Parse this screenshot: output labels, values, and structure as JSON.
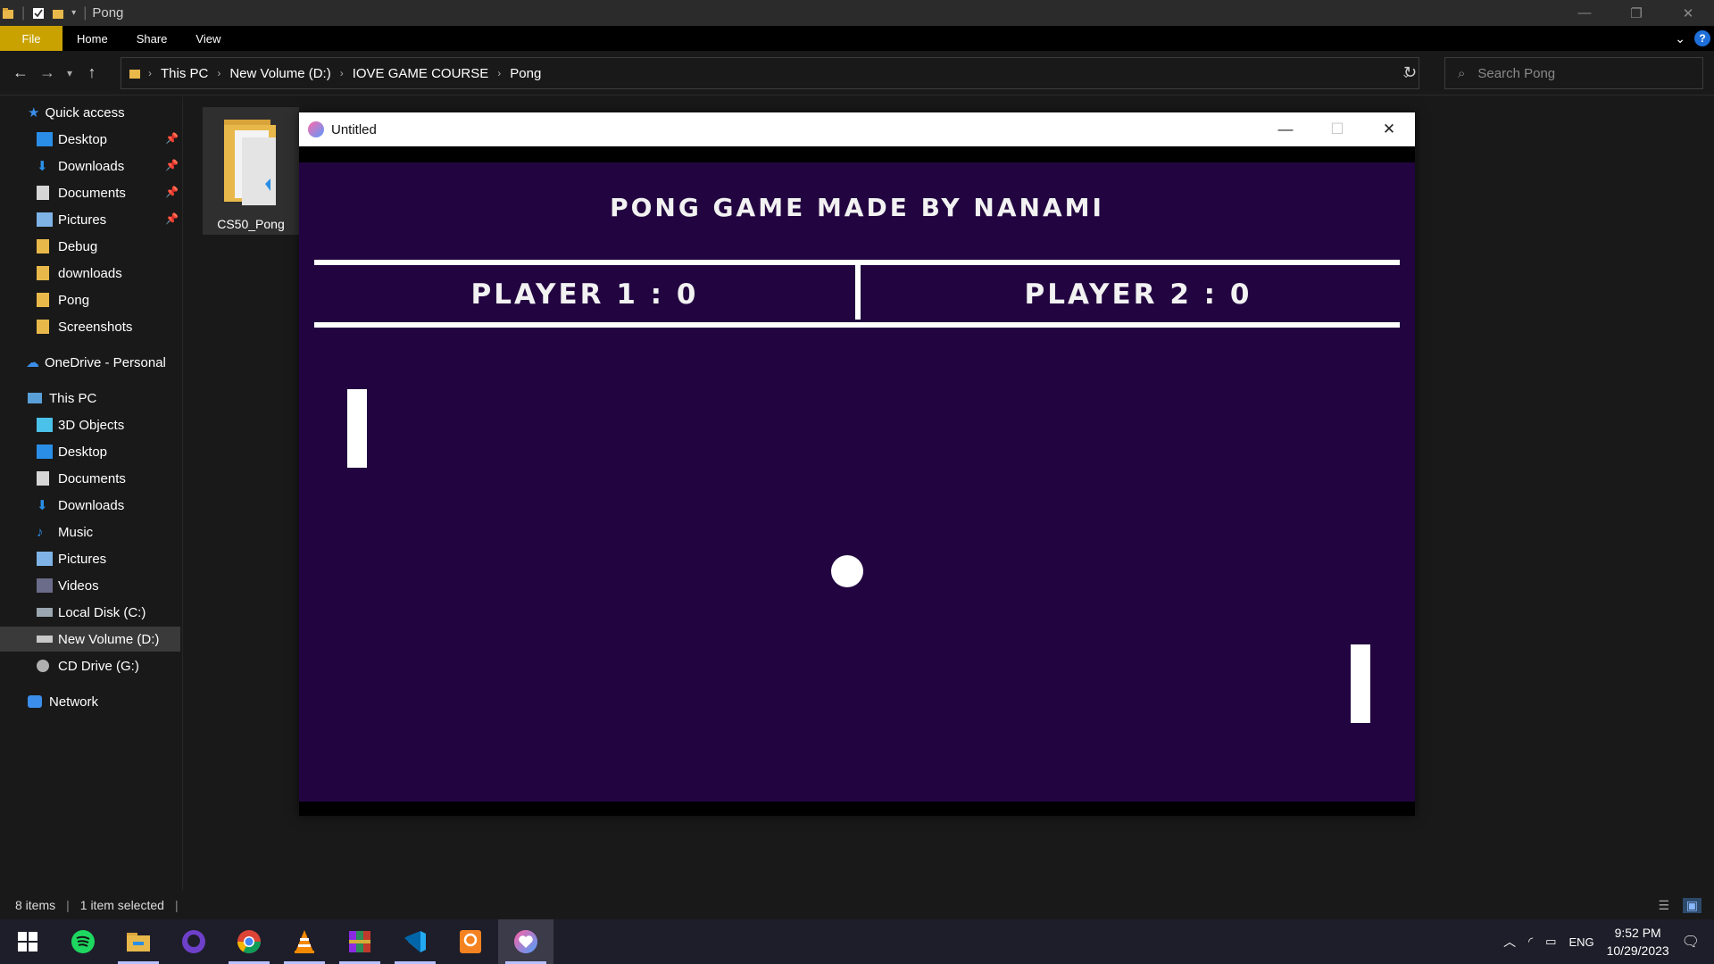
{
  "window": {
    "title": "Pong",
    "controls": {
      "minimize": "—",
      "restore": "❐",
      "close": "✕"
    }
  },
  "ribbon": {
    "tabs": [
      "File",
      "Home",
      "Share",
      "View"
    ],
    "help": "?"
  },
  "address": {
    "breadcrumbs": [
      "This PC",
      "New Volume (D:)",
      "IOVE GAME COURSE",
      "Pong"
    ],
    "search_placeholder": "Search Pong"
  },
  "sidebar": {
    "quick_access": "Quick access",
    "quick_items": [
      "Desktop",
      "Downloads",
      "Documents",
      "Pictures",
      "Debug",
      "downloads",
      "Pong",
      "Screenshots"
    ],
    "onedrive": "OneDrive - Personal",
    "this_pc": "This PC",
    "pc_items": [
      "3D Objects",
      "Desktop",
      "Documents",
      "Downloads",
      "Music",
      "Pictures",
      "Videos",
      "Local Disk (C:)",
      "New Volume (D:)",
      "CD Drive (G:)"
    ],
    "network": "Network",
    "selected": "New Volume (D:)"
  },
  "content": {
    "items": [
      {
        "name": "CS50_Pong",
        "type": "folder"
      }
    ]
  },
  "status": {
    "count": "8 items",
    "selection": "1 item selected"
  },
  "game_window": {
    "title": "Untitled",
    "heading": "PONG GAME MADE BY NANAMI",
    "player1": "PLAYER 1 : 0",
    "player2": "PLAYER 2 : 0",
    "background_color": "#220540"
  },
  "taskbar": {
    "apps": [
      "start-icon",
      "spotify-icon",
      "file-explorer-icon",
      "github-desktop-icon",
      "chrome-icon",
      "vlc-icon",
      "winrar-icon",
      "vscode-icon",
      "pdf-app-icon",
      "love2d-icon"
    ],
    "language": "ENG",
    "time": "9:52 PM",
    "date": "10/29/2023"
  }
}
